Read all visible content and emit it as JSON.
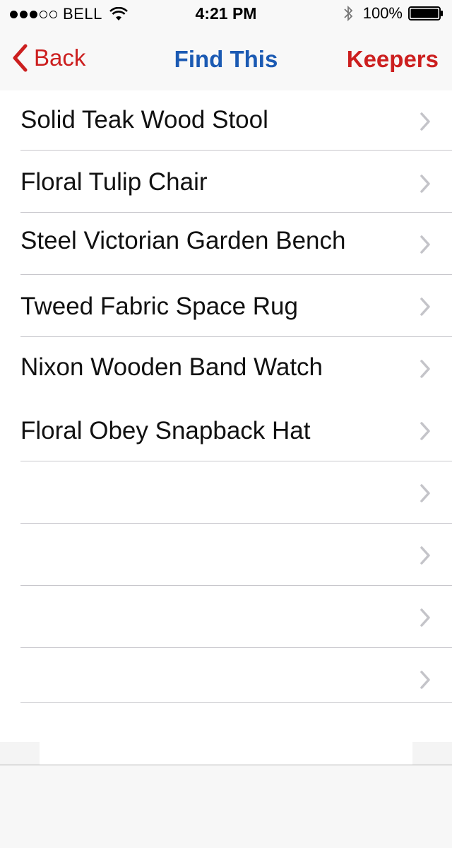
{
  "status_bar": {
    "signal_dots_filled": 3,
    "signal_dots_total": 5,
    "carrier": "BELL",
    "time": "4:21 PM",
    "battery_text": "100%",
    "battery_level": 1.0
  },
  "nav": {
    "back_label": "Back",
    "title": "Find This",
    "right_label": "Keepers",
    "colors": {
      "accent_red": "#cc1f1f",
      "title_blue": "#1b5ab3"
    }
  },
  "list": {
    "items": [
      {
        "label": "Solid Teak Wood Stool"
      },
      {
        "label": "Floral Tulip Chair"
      },
      {
        "label": "Steel Victorian Garden Bench"
      },
      {
        "label": "Tweed Fabric Space Rug"
      },
      {
        "label": "Nixon Wooden Band Watch"
      },
      {
        "label": "Floral Obey Snapback Hat"
      },
      {
        "label": ""
      },
      {
        "label": ""
      },
      {
        "label": ""
      },
      {
        "label": ""
      }
    ]
  },
  "icons": {
    "back": "chevron-left-icon",
    "disclosure": "chevron-right-icon",
    "wifi": "wifi-icon",
    "bluetooth": "bluetooth-icon",
    "battery": "battery-icon"
  }
}
